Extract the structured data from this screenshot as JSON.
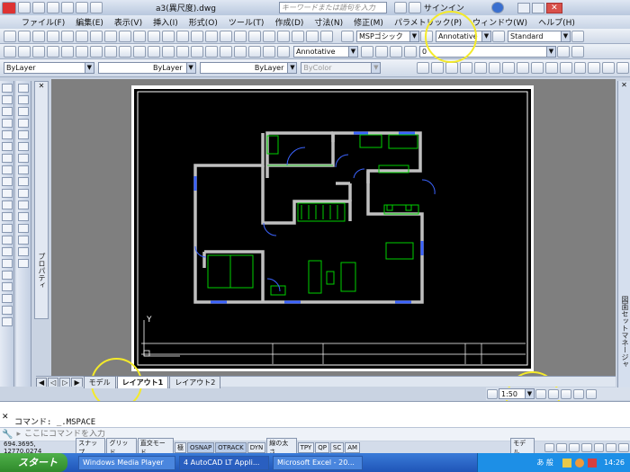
{
  "window": {
    "title": "a3(異尺度).dwg",
    "search_placeholder": "キーワードまたは語句を入力",
    "signin": "サインイン"
  },
  "menu": [
    "ファイル(F)",
    "編集(E)",
    "表示(V)",
    "挿入(I)",
    "形式(O)",
    "ツール(T)",
    "作成(D)",
    "寸法(N)",
    "修正(M)",
    "パラメトリック(P)",
    "ウィンドウ(W)",
    "ヘルプ(H)"
  ],
  "toolbar": {
    "text_style": "MSPゴシック",
    "annotative": "Annotative",
    "dim_style": "Standard",
    "layer": "0",
    "annotative2": "Annotative"
  },
  "properties": {
    "layer": "ByLayer",
    "linetype": "ByLayer",
    "lineweight": "ByLayer",
    "color": "ByColor"
  },
  "palette": {
    "properties_label": "プロパティ",
    "sheetset_label": "図面セットマネージャ"
  },
  "tabs": [
    {
      "label": "モデル",
      "active": false
    },
    {
      "label": "レイアウト1",
      "active": true
    },
    {
      "label": "レイアウト2",
      "active": false
    }
  ],
  "viewport": {
    "scale": "1:50"
  },
  "command": {
    "history": "コマンド:  _.MSPACE",
    "prompt": "ここにコマンドを入力"
  },
  "status": {
    "coords": "694.3695, 12770.0274",
    "buttons": [
      "スナップ",
      "グリッド",
      "直交モード",
      "極",
      "OSNAP",
      "OTRACK",
      "DYN",
      "線の太さ",
      "TPY",
      "QP",
      "SC",
      "AM"
    ],
    "model_label": "モデル"
  },
  "taskbar": {
    "start": "スタート",
    "tasks": [
      "Windows Media Player",
      "4 AutoCAD LT Appli...",
      "Microsoft Excel - 20..."
    ],
    "clock": "14:26",
    "ime": "あ 般"
  },
  "colors": {
    "canvas": "#000000",
    "wall": "#c0c0c0",
    "fixture": "#00d000",
    "door": "#3c64ff",
    "highlight": "#f4ea2a"
  }
}
